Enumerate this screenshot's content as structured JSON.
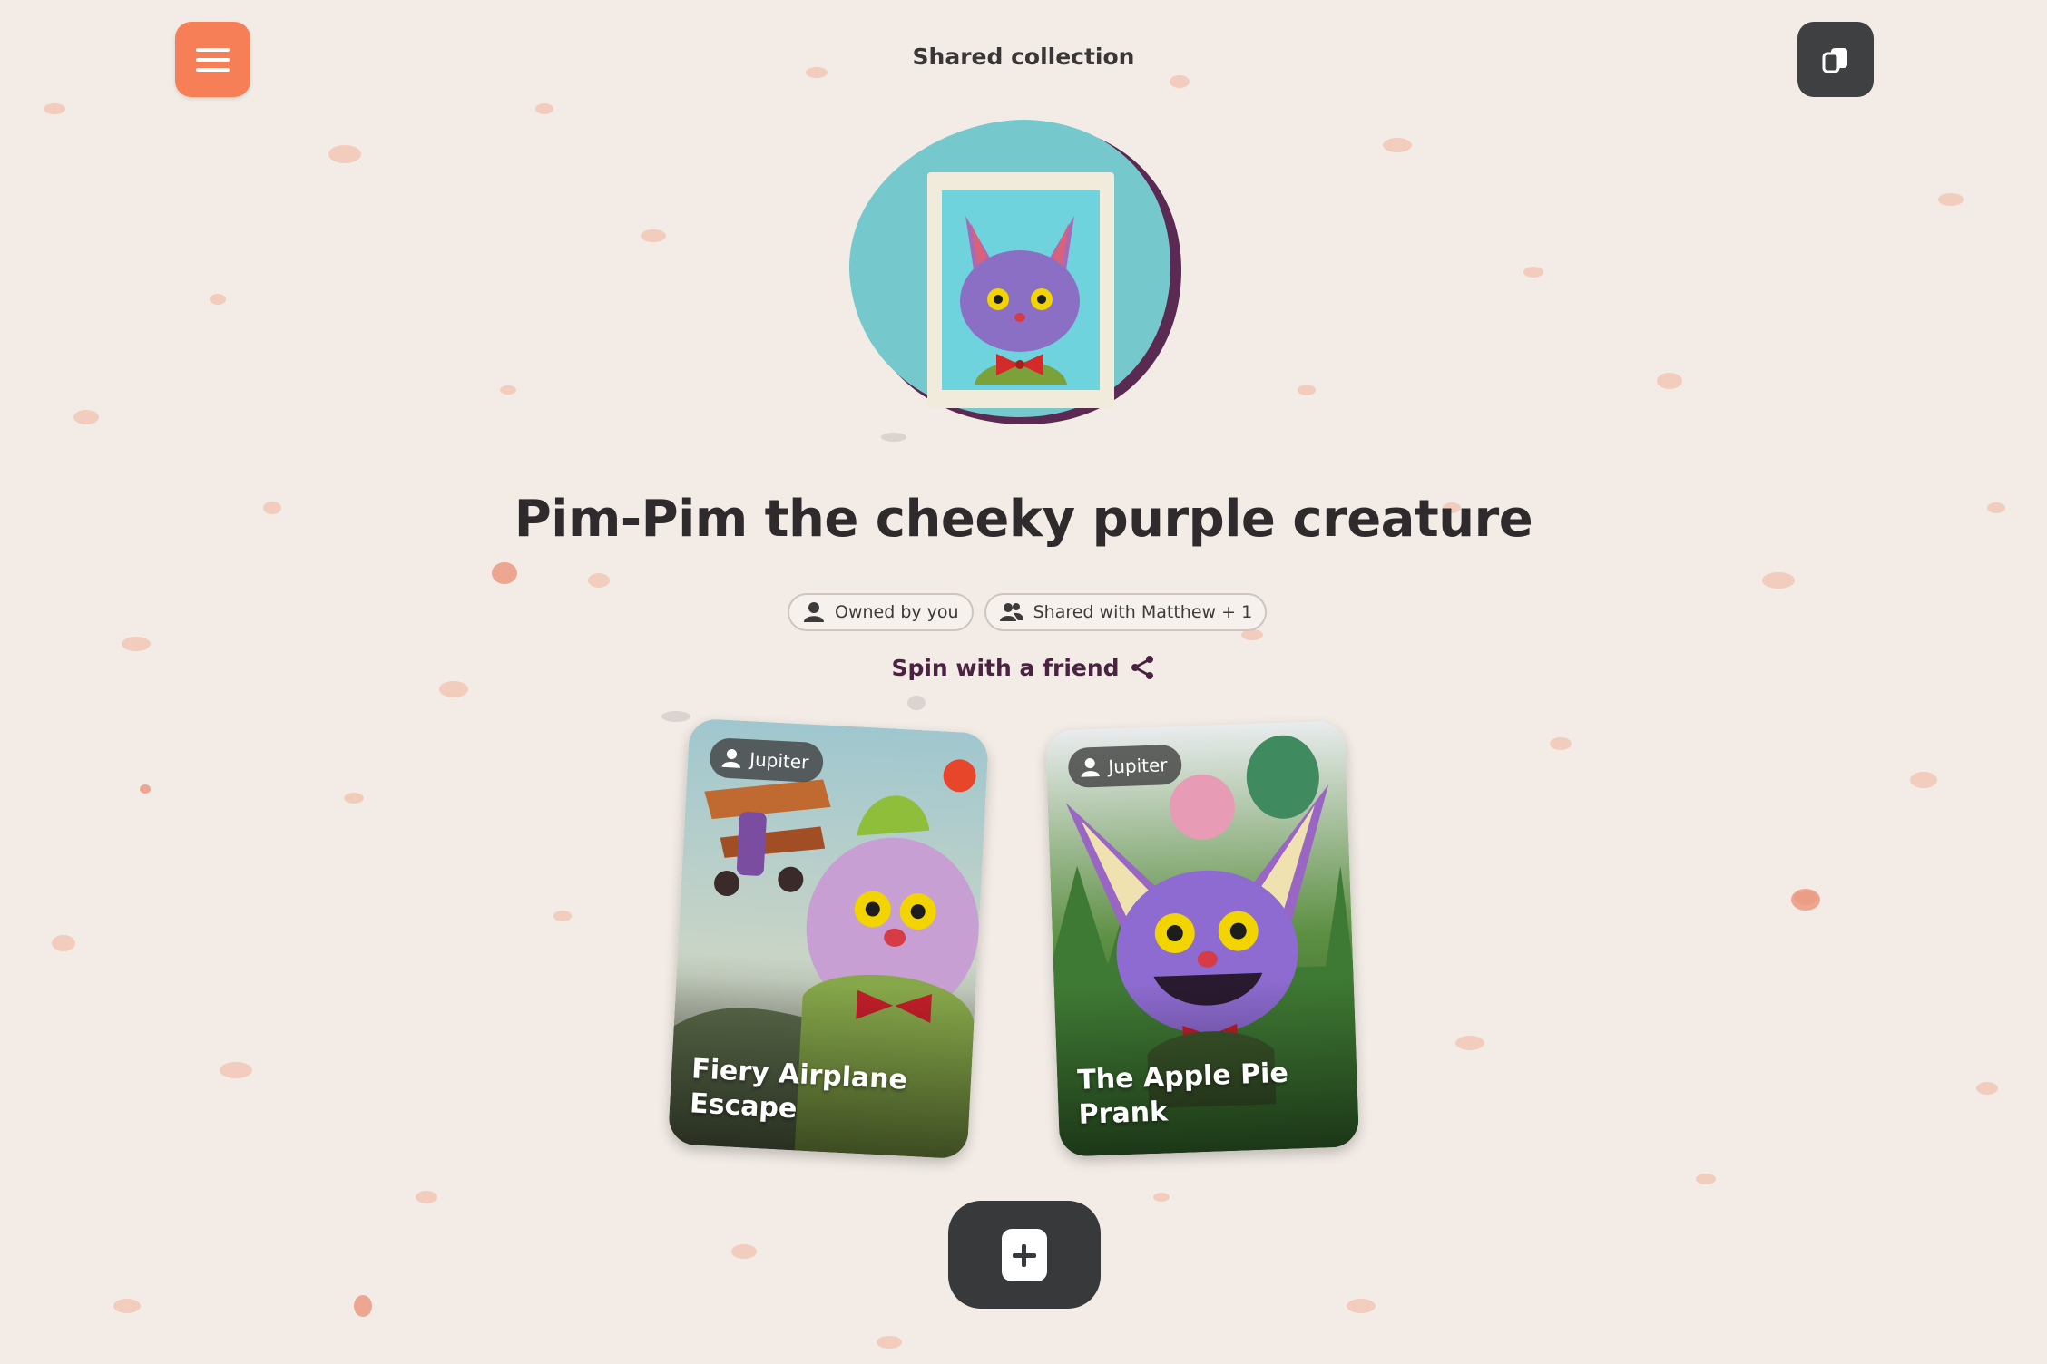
{
  "header": {
    "title": "Shared collection",
    "menu_icon": "hamburger-menu-icon",
    "cards_icon": "cards-stack-icon"
  },
  "collection": {
    "title": "Pim-Pim the cheeky purple creature",
    "avatar_icon": "creature-portrait",
    "owned_label": "Owned by you",
    "shared_label": "Shared with Matthew + 1",
    "spin_label": "Spin with a friend"
  },
  "stories": [
    {
      "author": "Jupiter",
      "title": "Fiery Airplane Escape"
    },
    {
      "author": "Jupiter",
      "title": "The Apple Pie Prank"
    }
  ],
  "colors": {
    "background": "#f3ece6",
    "menu_button": "#f77f58",
    "dark_button": "#3f4041",
    "spin_text": "#4a2242"
  }
}
